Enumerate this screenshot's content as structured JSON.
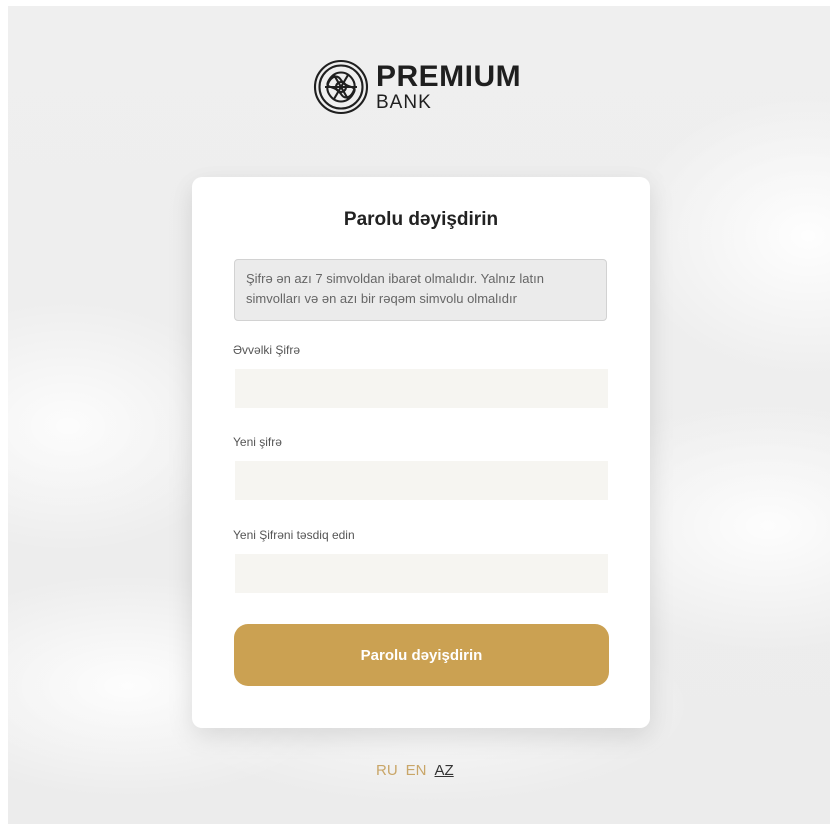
{
  "brand": {
    "title": "PREMIUM",
    "subtitle": "BANK"
  },
  "form": {
    "title": "Parolu dəyişdirin",
    "info": "Şifrə ən azı 7 simvoldan ibarət olmalıdır. Yalnız latın simvolları və ən azı bir rəqəm simvolu olmalıdır",
    "fields": [
      {
        "label": "Əvvəlki Şifrə",
        "value": ""
      },
      {
        "label": "Yeni şifrə",
        "value": ""
      },
      {
        "label": "Yeni Şifrəni təsdiq edin",
        "value": ""
      }
    ],
    "submit_label": "Parolu dəyişdirin"
  },
  "languages": [
    {
      "label": "RU",
      "active": false
    },
    {
      "label": "EN",
      "active": false
    },
    {
      "label": "AZ",
      "active": true
    }
  ],
  "colors": {
    "accent": "#cba152",
    "input_bg": "#f6f5f1",
    "lang_inactive": "#c9a668"
  },
  "icons": {
    "logo": "premium-bank-knot-logo"
  }
}
